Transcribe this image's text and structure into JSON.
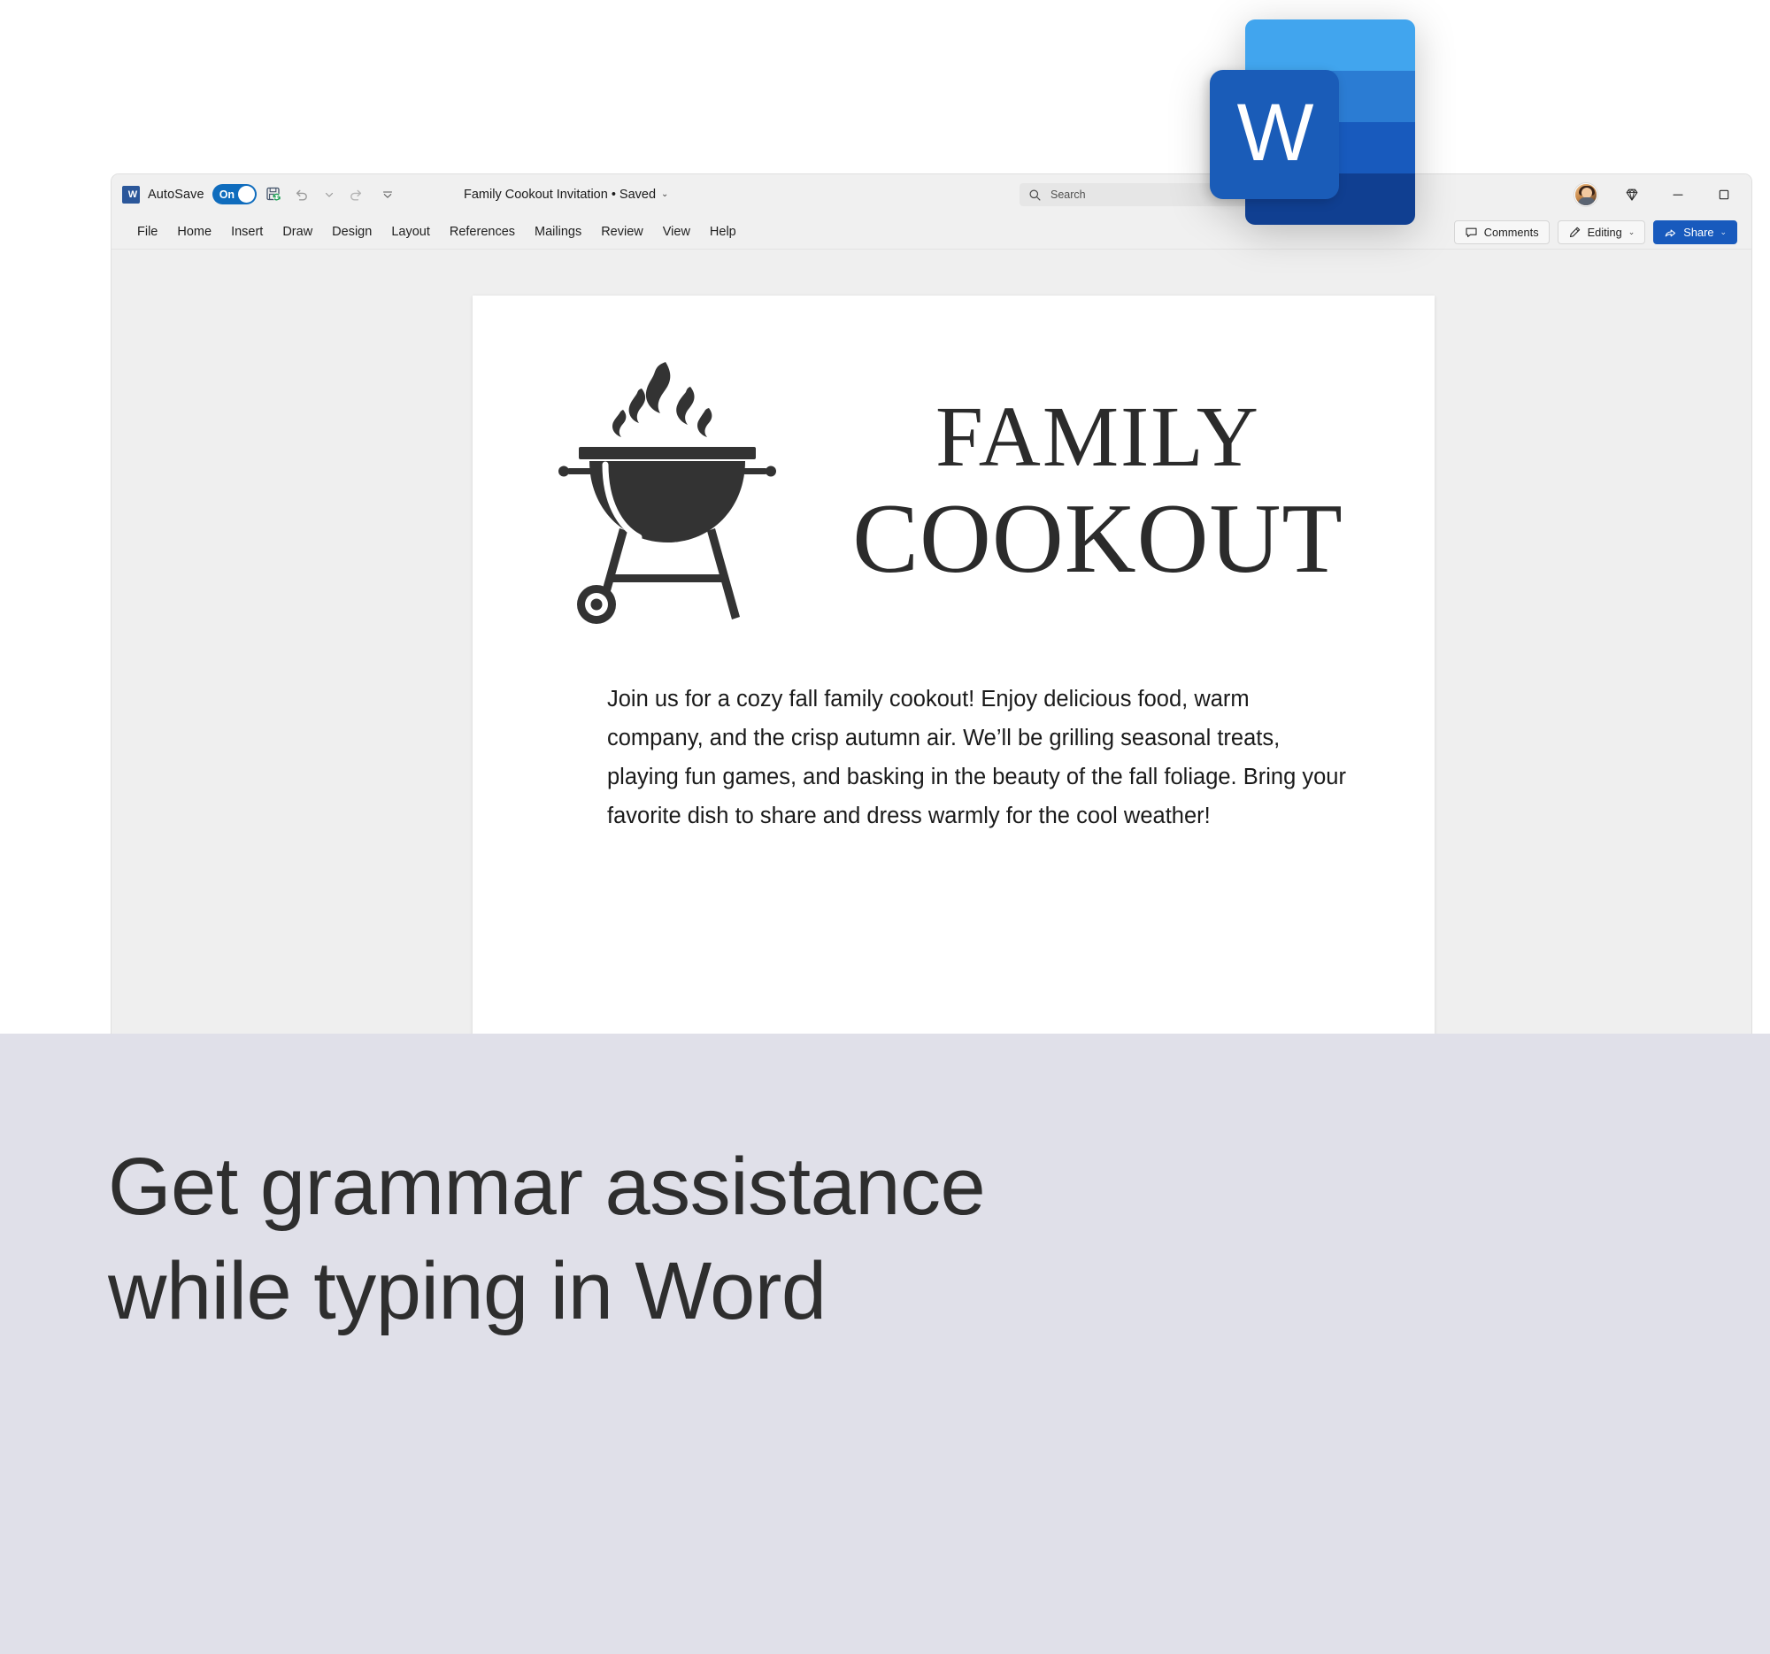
{
  "window": {
    "autosave_label": "AutoSave",
    "autosave_state": "On",
    "document_title": "Family Cookout Invitation • Saved",
    "title_chevron": "⌄"
  },
  "quick_access": [
    {
      "name": "save-icon",
      "glyph": "save"
    },
    {
      "name": "undo-icon",
      "glyph": "undo"
    },
    {
      "name": "undo-dropdown-icon",
      "glyph": "chevron-down"
    },
    {
      "name": "redo-icon",
      "glyph": "redo"
    },
    {
      "name": "customize-quick-access-toolbar-icon",
      "glyph": "chevron-double-down"
    }
  ],
  "search": {
    "placeholder": "Search",
    "icon": "search-icon"
  },
  "title_bar_right": {
    "account_avatar": "avatar",
    "copilot_icon": "diamond-icon",
    "minimize": "minimize-icon",
    "maximize": "maximize-icon"
  },
  "ribbon": {
    "tabs": [
      {
        "label": "File"
      },
      {
        "label": "Home"
      },
      {
        "label": "Insert"
      },
      {
        "label": "Draw"
      },
      {
        "label": "Design"
      },
      {
        "label": "Layout"
      },
      {
        "label": "References"
      },
      {
        "label": "Mailings"
      },
      {
        "label": "Review"
      },
      {
        "label": "View"
      },
      {
        "label": "Help"
      }
    ],
    "comments_label": "Comments",
    "editing_label": "Editing",
    "share_label": "Share",
    "chevron": "⌄"
  },
  "document": {
    "title_line1": "FAMILY",
    "title_line2": "COOKOUT",
    "body": "Join us for a cozy fall family cookout! Enjoy delicious food, warm company, and the crisp autumn air. We’ll be grilling seasonal treats, playing fun games, and basking in the beauty of the fall foliage. Bring your favorite dish to share and dress warmly for the cool weather!",
    "illustration": "bbq-grill-icon"
  },
  "app_logo": {
    "name": "word-app-logo",
    "letter": "W",
    "band_colors": [
      "#41a5ee",
      "#2b7cd3",
      "#185abd",
      "#103f91"
    ],
    "tile_color": "#1a5cb8"
  },
  "caption": {
    "line1": "Get grammar assistance",
    "line2": "while typing in Word"
  },
  "colors": {
    "accent": "#185abd",
    "toggle_on": "#0f6cbd",
    "canvas": "#efefef",
    "chrome": "#f0f0f0",
    "caption_bg": "#e0e0e9"
  }
}
